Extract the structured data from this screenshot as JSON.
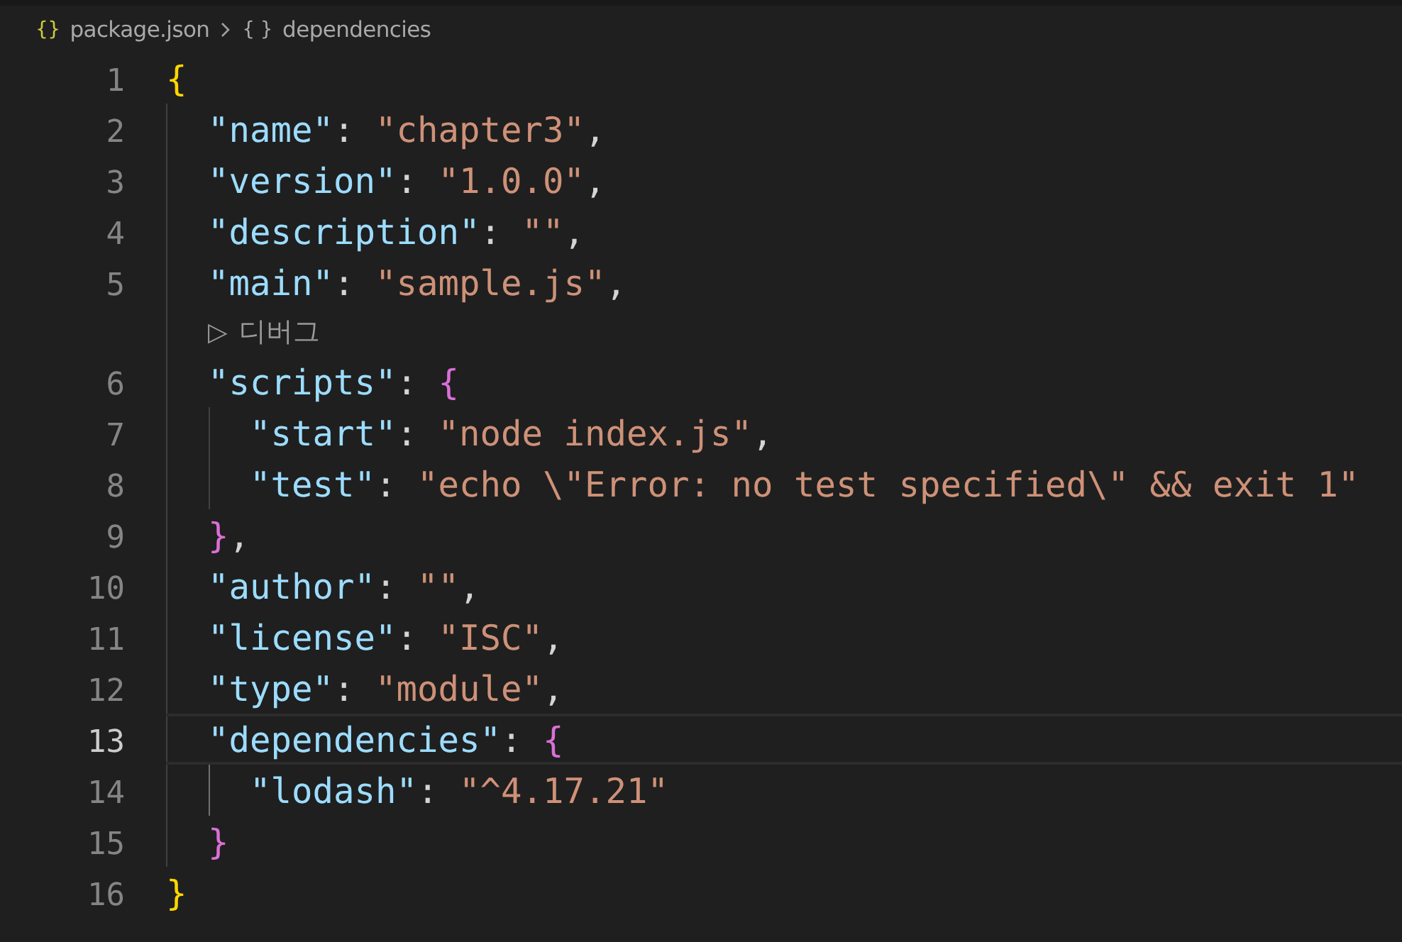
{
  "breadcrumb": [
    {
      "kind": "file",
      "icon": "{}",
      "label": "package.json"
    },
    {
      "kind": "object",
      "icon": "{ }",
      "label": "dependencies"
    }
  ],
  "lines": [
    {
      "kind": "code",
      "number": "1",
      "current": false,
      "tokens": [
        {
          "kind": "brace1",
          "text": "{"
        }
      ],
      "children": [
        {
          "kind": "code",
          "number": "2",
          "current": false,
          "tokens": [
            {
              "kind": "key",
              "text": "\"name\""
            },
            {
              "kind": "punct",
              "text": ": "
            },
            {
              "kind": "string",
              "text": "\"chapter3\""
            },
            {
              "kind": "punct",
              "text": ","
            }
          ]
        },
        {
          "kind": "code",
          "number": "3",
          "current": false,
          "tokens": [
            {
              "kind": "key",
              "text": "\"version\""
            },
            {
              "kind": "punct",
              "text": ": "
            },
            {
              "kind": "string",
              "text": "\"1.0.0\""
            },
            {
              "kind": "punct",
              "text": ","
            }
          ]
        },
        {
          "kind": "code",
          "number": "4",
          "current": false,
          "tokens": [
            {
              "kind": "key",
              "text": "\"description\""
            },
            {
              "kind": "punct",
              "text": ": "
            },
            {
              "kind": "string",
              "text": "\"\""
            },
            {
              "kind": "punct",
              "text": ","
            }
          ]
        },
        {
          "kind": "code",
          "number": "5",
          "current": false,
          "tokens": [
            {
              "kind": "key",
              "text": "\"main\""
            },
            {
              "kind": "punct",
              "text": ": "
            },
            {
              "kind": "string",
              "text": "\"sample.js\""
            },
            {
              "kind": "punct",
              "text": ","
            }
          ]
        },
        {
          "kind": "codelens",
          "icon": "▷",
          "label": "디버그"
        },
        {
          "kind": "code",
          "number": "6",
          "current": false,
          "tokens": [
            {
              "kind": "key",
              "text": "\"scripts\""
            },
            {
              "kind": "punct",
              "text": ": "
            },
            {
              "kind": "brace2",
              "text": "{"
            }
          ],
          "children": [
            {
              "kind": "code",
              "number": "7",
              "current": false,
              "tokens": [
                {
                  "kind": "key",
                  "text": "\"start\""
                },
                {
                  "kind": "punct",
                  "text": ": "
                },
                {
                  "kind": "string",
                  "text": "\"node index.js\""
                },
                {
                  "kind": "punct",
                  "text": ","
                }
              ]
            },
            {
              "kind": "code",
              "number": "8",
              "current": false,
              "tokens": [
                {
                  "kind": "key",
                  "text": "\"test\""
                },
                {
                  "kind": "punct",
                  "text": ": "
                },
                {
                  "kind": "string",
                  "text": "\"echo \\\"Error: no test specified\\\" && exit 1\""
                }
              ]
            }
          ]
        },
        {
          "kind": "code",
          "number": "9",
          "current": false,
          "tokens": [
            {
              "kind": "brace2",
              "text": "}"
            },
            {
              "kind": "punct",
              "text": ","
            }
          ]
        },
        {
          "kind": "code",
          "number": "10",
          "current": false,
          "tokens": [
            {
              "kind": "key",
              "text": "\"author\""
            },
            {
              "kind": "punct",
              "text": ": "
            },
            {
              "kind": "string",
              "text": "\"\""
            },
            {
              "kind": "punct",
              "text": ","
            }
          ]
        },
        {
          "kind": "code",
          "number": "11",
          "current": false,
          "tokens": [
            {
              "kind": "key",
              "text": "\"license\""
            },
            {
              "kind": "punct",
              "text": ": "
            },
            {
              "kind": "string",
              "text": "\"ISC\""
            },
            {
              "kind": "punct",
              "text": ","
            }
          ]
        },
        {
          "kind": "code",
          "number": "12",
          "current": false,
          "tokens": [
            {
              "kind": "key",
              "text": "\"type\""
            },
            {
              "kind": "punct",
              "text": ": "
            },
            {
              "kind": "string",
              "text": "\"module\""
            },
            {
              "kind": "punct",
              "text": ","
            }
          ]
        },
        {
          "kind": "code",
          "number": "13",
          "current": true,
          "tokens": [
            {
              "kind": "key",
              "text": "\"dependencies\""
            },
            {
              "kind": "punct",
              "text": ": "
            },
            {
              "kind": "brace2",
              "text": "{"
            }
          ],
          "children": [
            {
              "kind": "code",
              "number": "14",
              "current": false,
              "tokens": [
                {
                  "kind": "key",
                  "text": "\"lodash\""
                },
                {
                  "kind": "punct",
                  "text": ": "
                },
                {
                  "kind": "string",
                  "text": "\"^4.17.21\""
                }
              ]
            }
          ]
        },
        {
          "kind": "code",
          "number": "15",
          "current": false,
          "tokens": [
            {
              "kind": "brace2",
              "text": "}"
            }
          ]
        }
      ]
    },
    {
      "kind": "code",
      "number": "16",
      "current": false,
      "tokens": [
        {
          "kind": "brace1",
          "text": "}"
        }
      ]
    }
  ]
}
